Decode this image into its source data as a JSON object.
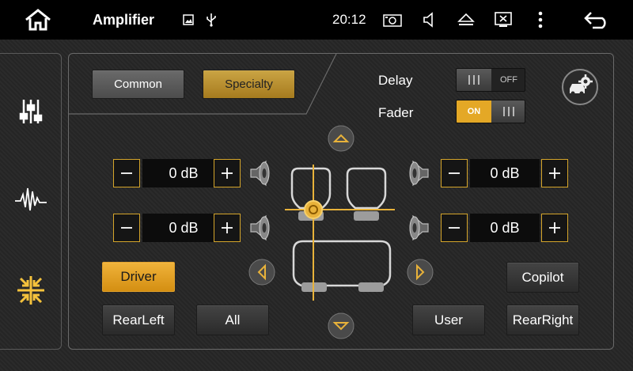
{
  "status": {
    "title": "Amplifier",
    "time": "20:12"
  },
  "tabs": {
    "common": "Common",
    "specialty": "Specialty"
  },
  "toggles": {
    "delay": {
      "label": "Delay",
      "state": "OFF"
    },
    "fader": {
      "label": "Fader",
      "state": "ON"
    }
  },
  "channels": {
    "front_left": "0 dB",
    "front_right": "0 dB",
    "rear_left": "0 dB",
    "rear_right": "0 dB"
  },
  "positions": {
    "driver": "Driver",
    "copilot": "Copilot",
    "rear_left": "RearLeft",
    "all": "All",
    "user": "User",
    "rear_right": "RearRight"
  },
  "colors": {
    "accent": "#f0b33a",
    "panel_border": "#6a6a6a",
    "status_bar": "#000000"
  },
  "icons": {
    "status": [
      "home-icon",
      "image-icon",
      "usb-icon",
      "camera-icon",
      "volume-icon",
      "eject-icon",
      "close-window-icon",
      "more-icon",
      "back-icon"
    ],
    "sidebar": [
      "equalizer-icon",
      "waveform-icon",
      "sound-field-icon"
    ]
  }
}
